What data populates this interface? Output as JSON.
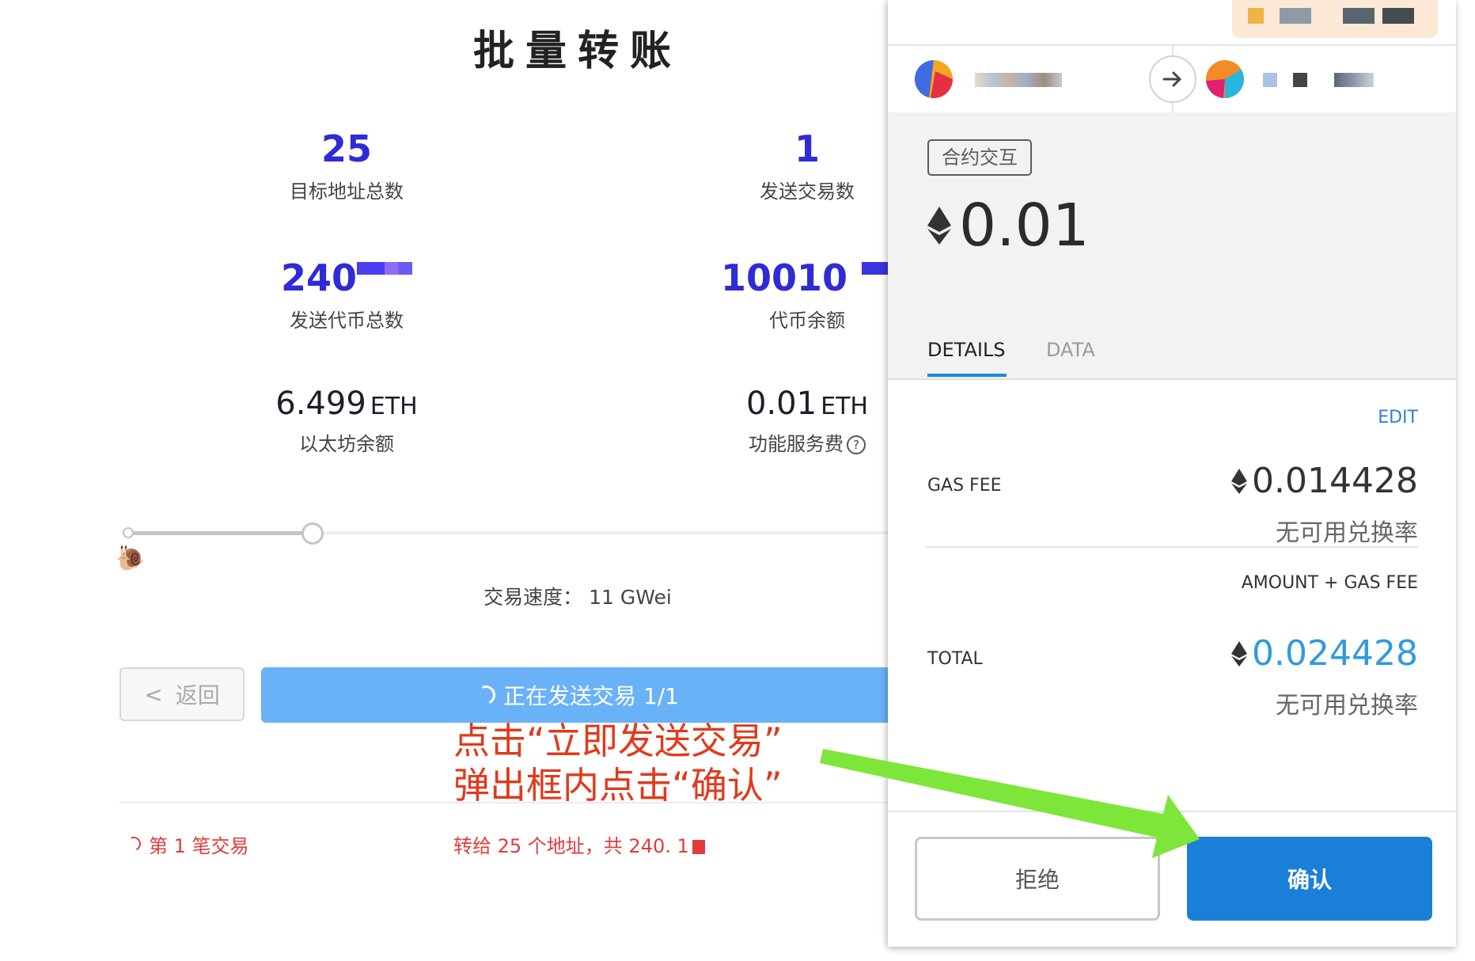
{
  "dapp": {
    "title": "批量转账",
    "stats": {
      "target_addresses": {
        "value": "25",
        "label": "目标地址总数"
      },
      "tx_count": {
        "value": "1",
        "label": "发送交易数"
      },
      "tokens_total": {
        "value": "240",
        "label": "发送代币总数"
      },
      "token_balance": {
        "value": "10010",
        "label": "代币余额"
      },
      "eth_balance": {
        "value": "6.499",
        "unit": "ETH",
        "label": "以太坊余额"
      },
      "service_fee": {
        "value": "0.01",
        "unit": "ETH",
        "label": "功能服务费"
      }
    },
    "help_glyph": "?",
    "speed_text": "交易速度： 11 GWei",
    "back_label": "返回",
    "back_glyph": "<",
    "send_label": "正在发送交易 1/1",
    "annotation_line1": "点击“立即发送交易”",
    "annotation_line2": "弹出框内点击“确认”",
    "tx_row_label": "第 1 笔交易",
    "tx_row_detail": "转给 25 个地址，共 240",
    "tx_row_suffix": ". 1"
  },
  "metamask": {
    "tx_type": "合约交互",
    "amount": "0.01",
    "tabs": {
      "details": "DETAILS",
      "data": "DATA"
    },
    "edit_label": "EDIT",
    "gas_fee_label": "GAS FEE",
    "gas_fee_value": "0.014428",
    "gas_fee_sub": "无可用兑换率",
    "total_caption": "AMOUNT + GAS FEE",
    "total_label": "TOTAL",
    "total_value": "0.024428",
    "total_sub": "无可用兑换率",
    "reject_label": "拒绝",
    "confirm_label": "确认"
  },
  "colors": {
    "stat_blue": "#2f2bd6",
    "send_button": "#6ab2f8",
    "annotation_red": "#e03a1d",
    "confirm_blue": "#1a7fd7",
    "total_blue": "#2f9ae0",
    "arrow_green": "#7ee63a"
  }
}
